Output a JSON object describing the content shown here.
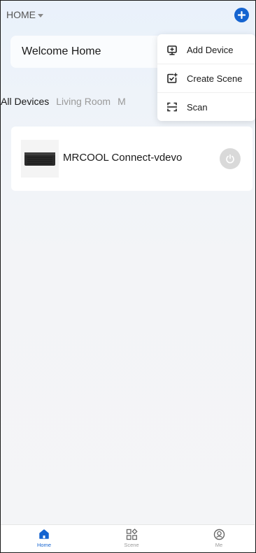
{
  "header": {
    "home_label": "HOME",
    "welcome_text": "Welcome Home"
  },
  "menu": {
    "items": [
      {
        "label": "Add Device",
        "icon": "add-device-icon"
      },
      {
        "label": "Create Scene",
        "icon": "create-scene-icon"
      },
      {
        "label": "Scan",
        "icon": "scan-icon"
      }
    ]
  },
  "tabs": [
    {
      "label": "All Devices",
      "active": true
    },
    {
      "label": "Living Room",
      "active": false
    },
    {
      "label": "M",
      "active": false
    }
  ],
  "devices": [
    {
      "name": "MRCOOL Connect-vdevo",
      "icon": "mini-split-unit-image",
      "power": "off"
    }
  ],
  "bottom_nav": [
    {
      "label": "Home",
      "icon": "home-icon",
      "active": true
    },
    {
      "label": "Scene",
      "icon": "scene-icon",
      "active": false
    },
    {
      "label": "Me",
      "icon": "me-icon",
      "active": false
    }
  ],
  "colors": {
    "accent": "#1564d0",
    "power_off": "#d9d9d9",
    "inactive_text": "#999999"
  }
}
